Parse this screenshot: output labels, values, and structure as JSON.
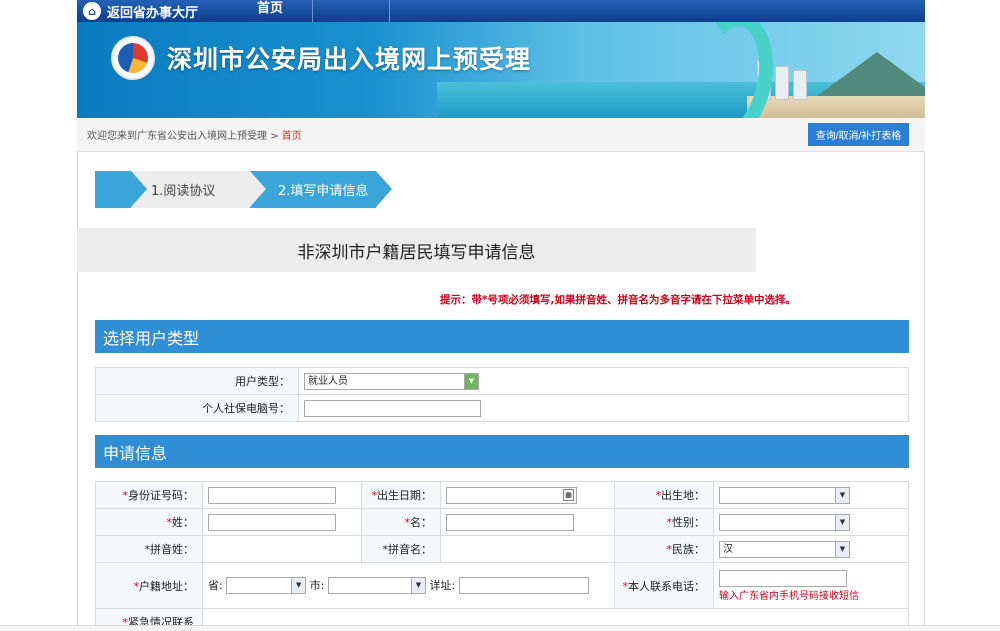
{
  "topnav": {
    "back_label": "返回省办事大厅",
    "home_label": "首页"
  },
  "banner": {
    "title": "深圳市公安局出入境网上预受理"
  },
  "breadcrumb": {
    "prefix": "欢迎您来到广东省公安出入境网上预受理",
    "sep": ">",
    "current": "首页"
  },
  "query_button": "查询/取消/补打表格",
  "steps": {
    "step1": "1.阅读协议",
    "step2": "2.填写申请信息"
  },
  "heading": "非深圳市户籍居民填写申请信息",
  "tip": "提示：带*号项必须填写,如果拼音姓、拼音名为多音字请在下拉菜单中选择。",
  "section_user_type": {
    "title": "选择用户类型",
    "user_type_label": "用户类型：",
    "user_type_value": "就业人员",
    "social_security_label": "个人社保电脑号："
  },
  "section_apply": {
    "title": "申请信息",
    "id_number_label": "身份证号码：",
    "birth_date_label": "出生日期：",
    "birth_place_label": "出生地：",
    "surname_label": "姓：",
    "given_name_label": "名：",
    "gender_label": "性别：",
    "pinyin_surname_label": "拼音姓：",
    "pinyin_given_label": "拼音名：",
    "ethnicity_label": "民族：",
    "ethnicity_value": "汉",
    "hukou_address_label": "户籍地址：",
    "province_label": "省:",
    "city_label": "市:",
    "detail_label": "详址:",
    "phone_label": "本人联系电话：",
    "phone_hint": "输入广东省内手机号码接收短信",
    "emergency_label": "紧急情况联系"
  },
  "required_mark": "*",
  "colors": {
    "section_bar": "#2f8ed4",
    "step_active": "#3aa5d8",
    "required": "#d0021b",
    "nav": "#1b4f9f"
  }
}
